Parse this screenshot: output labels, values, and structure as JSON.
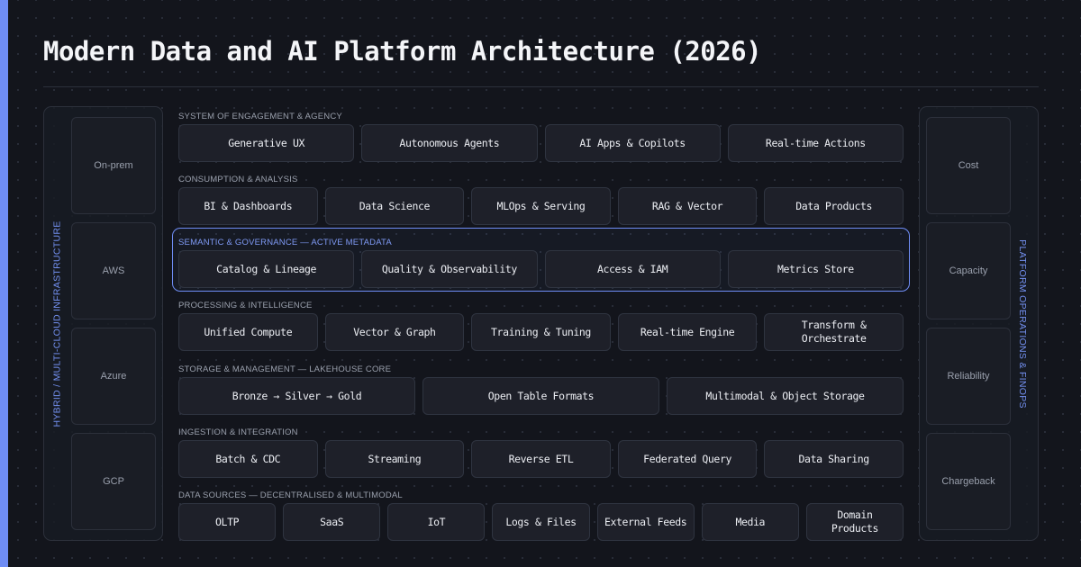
{
  "title": "Modern Data and AI Platform Architecture (2026)",
  "colors": {
    "accent": "#6f8df5",
    "background": "#13151c",
    "box": "#1e2029",
    "border": "#2f3440"
  },
  "left_panel": {
    "label": "HYBRID / MULTI-CLOUD INFRASTRUCTURE",
    "items": [
      "On-prem",
      "AWS",
      "Azure",
      "GCP"
    ]
  },
  "right_panel": {
    "label": "PLATFORM OPERATIONS & FINOPS",
    "items": [
      "Cost",
      "Capacity",
      "Reliability",
      "Chargeback"
    ]
  },
  "layers": [
    {
      "title": "SYSTEM OF ENGAGEMENT & AGENCY",
      "items": [
        "Generative UX",
        "Autonomous Agents",
        "AI Apps & Copilots",
        "Real-time Actions"
      ]
    },
    {
      "title": "CONSUMPTION & ANALYSIS",
      "items": [
        "BI & Dashboards",
        "Data Science",
        "MLOps & Serving",
        "RAG & Vector",
        "Data Products"
      ]
    },
    {
      "title": "SEMANTIC & GOVERNANCE — ACTIVE METADATA",
      "highlighted": true,
      "items": [
        "Catalog & Lineage",
        "Quality & Observability",
        "Access & IAM",
        "Metrics Store"
      ]
    },
    {
      "title": "PROCESSING & INTELLIGENCE",
      "items": [
        "Unified Compute",
        "Vector & Graph",
        "Training & Tuning",
        "Real-time Engine",
        "Transform & Orchestrate"
      ]
    },
    {
      "title": "STORAGE & MANAGEMENT — LAKEHOUSE CORE",
      "items": [
        "Bronze → Silver → Gold",
        "Open Table Formats",
        "Multimodal & Object Storage"
      ]
    },
    {
      "title": "INGESTION & INTEGRATION",
      "items": [
        "Batch & CDC",
        "Streaming",
        "Reverse ETL",
        "Federated Query",
        "Data Sharing"
      ]
    },
    {
      "title": "DATA SOURCES — DECENTRALISED & MULTIMODAL",
      "items": [
        "OLTP",
        "SaaS",
        "IoT",
        "Logs & Files",
        "External Feeds",
        "Media",
        "Domain Products"
      ]
    }
  ]
}
